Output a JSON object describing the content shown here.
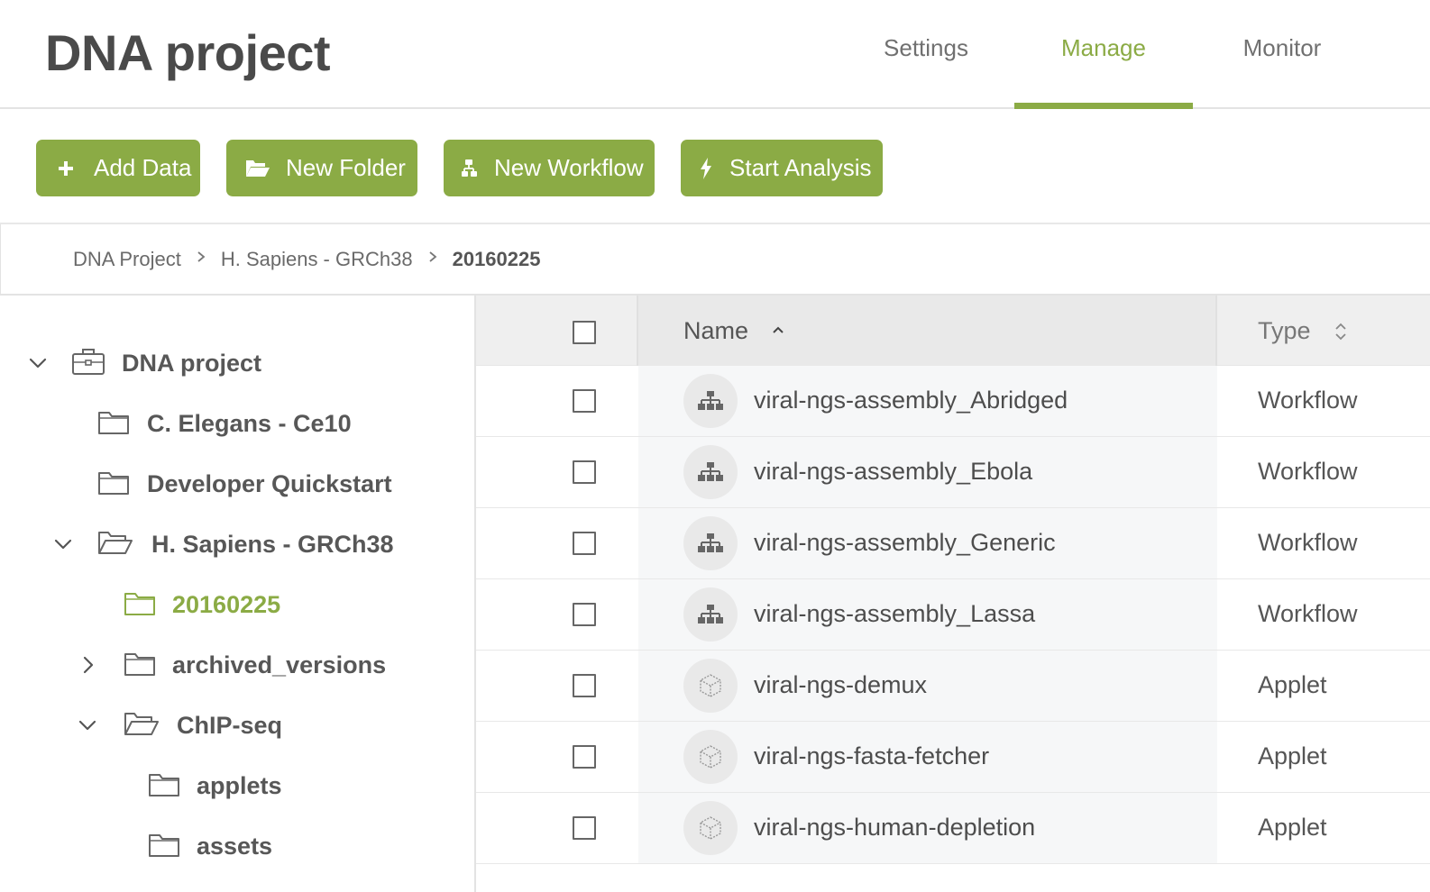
{
  "header": {
    "title": "DNA project",
    "tabs": [
      {
        "label": "Settings",
        "active": false
      },
      {
        "label": "Manage",
        "active": true
      },
      {
        "label": "Monitor",
        "active": false
      }
    ]
  },
  "toolbar": {
    "buttons": [
      {
        "label": "Add Data",
        "icon": "plus-icon"
      },
      {
        "label": "New Folder",
        "icon": "folder-open-icon"
      },
      {
        "label": "New Workflow",
        "icon": "workflow-icon"
      },
      {
        "label": "Start Analysis",
        "icon": "bolt-icon"
      }
    ]
  },
  "breadcrumb": {
    "items": [
      "DNA Project",
      "H. Sapiens - GRCh38"
    ],
    "current": "20160225",
    "separator": ">"
  },
  "sidebar": {
    "tree": [
      {
        "label": "DNA project",
        "icon": "briefcase-icon",
        "toggle": "expanded"
      },
      {
        "label": "C. Elegans - Ce10",
        "icon": "folder-icon",
        "toggle": "none"
      },
      {
        "label": "Developer Quickstart",
        "icon": "folder-icon",
        "toggle": "none"
      },
      {
        "label": "H. Sapiens - GRCh38",
        "icon": "folder-open-icon",
        "toggle": "expanded"
      },
      {
        "label": "20160225",
        "icon": "folder-icon",
        "toggle": "none",
        "selected": true
      },
      {
        "label": "archived_versions",
        "icon": "folder-icon",
        "toggle": "collapsed"
      },
      {
        "label": "ChIP-seq",
        "icon": "folder-open-icon",
        "toggle": "expanded"
      },
      {
        "label": "applets",
        "icon": "folder-icon",
        "toggle": "none"
      },
      {
        "label": "assets",
        "icon": "folder-icon",
        "toggle": "none"
      }
    ]
  },
  "table": {
    "columns": {
      "name": "Name",
      "name_sort": "ascending",
      "type": "Type"
    },
    "rows": [
      {
        "name": "viral-ngs-assembly_Abridged",
        "type": "Workflow",
        "icon": "workflow-icon"
      },
      {
        "name": "viral-ngs-assembly_Ebola",
        "type": "Workflow",
        "icon": "workflow-icon"
      },
      {
        "name": "viral-ngs-assembly_Generic",
        "type": "Workflow",
        "icon": "workflow-icon"
      },
      {
        "name": "viral-ngs-assembly_Lassa",
        "type": "Workflow",
        "icon": "workflow-icon"
      },
      {
        "name": "viral-ngs-demux",
        "type": "Applet",
        "icon": "applet-cube-icon"
      },
      {
        "name": "viral-ngs-fasta-fetcher",
        "type": "Applet",
        "icon": "applet-cube-icon"
      },
      {
        "name": "viral-ngs-human-depletion",
        "type": "Applet",
        "icon": "applet-cube-icon"
      }
    ]
  },
  "colors": {
    "accent": "#8bab45",
    "header_bg": "#efefef",
    "text": "#555555"
  }
}
